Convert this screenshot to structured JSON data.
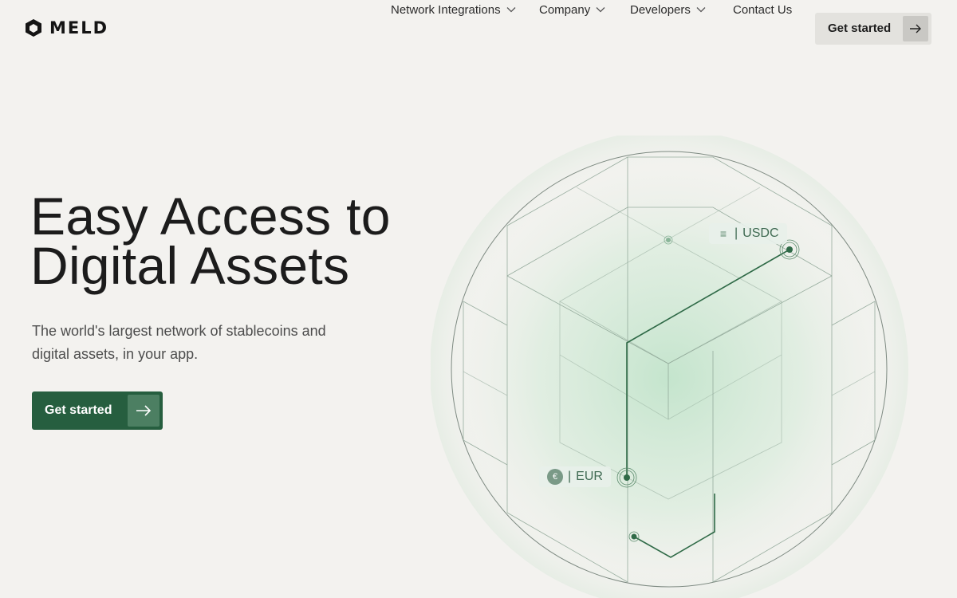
{
  "brand": {
    "name": "MELD"
  },
  "nav": {
    "items": [
      {
        "label": "Network Integrations",
        "has_dropdown": true
      },
      {
        "label": "Company",
        "has_dropdown": true
      },
      {
        "label": "Developers",
        "has_dropdown": true
      },
      {
        "label": "Contact Us",
        "has_dropdown": false
      }
    ],
    "cta_label": "Get started"
  },
  "hero": {
    "title_line1": "Easy Access to",
    "title_line2": "Digital Assets",
    "subtitle": "The world's largest network of stablecoins and digital assets, in your app.",
    "cta_label": "Get started"
  },
  "graphic": {
    "tokens": [
      {
        "symbol": "USDC",
        "separator": "|",
        "icon": "usdc-icon"
      },
      {
        "symbol": "EUR",
        "separator": "|",
        "icon": "euro-icon"
      }
    ],
    "accent_color": "#265e3f"
  },
  "colors": {
    "background": "#f3f2ef",
    "primary": "#265e3f",
    "primary_light": "#4c7f62"
  }
}
